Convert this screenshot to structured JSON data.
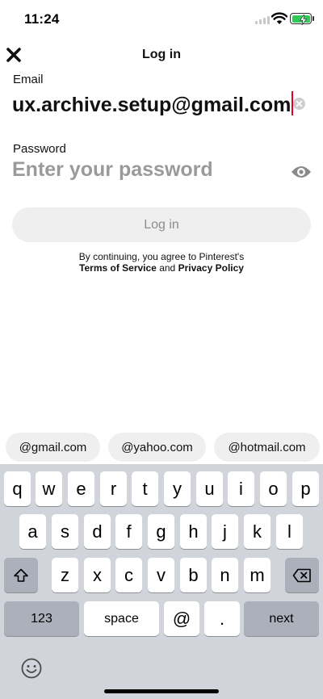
{
  "status_bar": {
    "time": "11:24"
  },
  "header": {
    "title": "Log in"
  },
  "email": {
    "label": "Email",
    "value": "ux.archive.setup@gmail.com"
  },
  "password": {
    "label": "Password",
    "placeholder": "Enter your password"
  },
  "login_button": {
    "label": "Log in"
  },
  "legal": {
    "line1": "By continuing, you agree to Pinterest's",
    "terms": "Terms of Service",
    "and": "and",
    "privacy": "Privacy Policy"
  },
  "suggestions": [
    "@gmail.com",
    "@yahoo.com",
    "@hotmail.com"
  ],
  "keyboard": {
    "row1": [
      "q",
      "w",
      "e",
      "r",
      "t",
      "y",
      "u",
      "i",
      "o",
      "p"
    ],
    "row2": [
      "a",
      "s",
      "d",
      "f",
      "g",
      "h",
      "j",
      "k",
      "l"
    ],
    "row3": [
      "z",
      "x",
      "c",
      "v",
      "b",
      "n",
      "m"
    ],
    "numbers": "123",
    "space": "space",
    "at": "@",
    "dot": ".",
    "next": "next"
  },
  "colors": {
    "accent_caret": "#e60023",
    "battery": "#34c759",
    "keyboard_bg": "#d1d4da"
  },
  "icons": [
    "close-icon",
    "wifi-icon",
    "battery-icon",
    "clear-icon",
    "eye-icon",
    "shift-icon",
    "backspace-icon",
    "emoji-icon"
  ]
}
